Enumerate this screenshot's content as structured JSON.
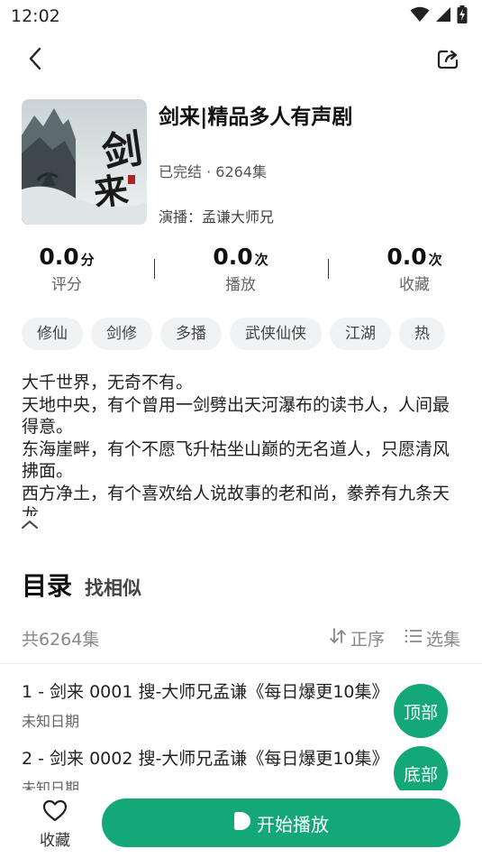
{
  "status_bar": {
    "time": "12:02",
    "icons": [
      "wifi-icon",
      "cellular-signal-icon",
      "battery-charging-icon"
    ]
  },
  "topbar": {
    "back_icon": "chevron-left-icon",
    "share_icon": "share-icon"
  },
  "book": {
    "title": "剑来|精品多人有声剧",
    "meta": "已完结 · 6264集",
    "cast": "演播：孟谦大师兄",
    "cover_text": "剑来"
  },
  "stats": [
    {
      "value": "0.0",
      "unit": "分",
      "label": "评分"
    },
    {
      "value": "0.0",
      "unit": "次",
      "label": "播放"
    },
    {
      "value": "0.0",
      "unit": "次",
      "label": "收藏"
    }
  ],
  "tags": [
    "修仙",
    "剑修",
    "多播",
    "武侠仙侠",
    "江湖",
    "热"
  ],
  "intro": [
    "大千世界，无奇不有。",
    "天地中央，有个曾用一剑劈出天河瀑布的读书人，人间最得意。",
    "东海崖畔，有个不愿飞升枯坐山巅的无名道人，只愿清风拂面。",
    "西方净土，有个喜欢给人说故事的老和尚，豢养有九条天龙"
  ],
  "section": {
    "title": "目录",
    "similar": "找相似"
  },
  "list": {
    "total": "共6264集",
    "sort_label": "正序",
    "select_label": "选集"
  },
  "episodes": [
    {
      "title": "1 - 剑来 0001 搜-大师兄孟谦《每日爆更10集》",
      "date": "未知日期"
    },
    {
      "title": "2 - 剑来 0002 搜-大师兄孟谦《每日爆更10集》",
      "date": "未知日期"
    }
  ],
  "floating": {
    "top_label": "顶部",
    "bottom_label": "底部"
  },
  "bottom_bar": {
    "fav_label": "收藏",
    "play_label": "开始播放"
  },
  "colors": {
    "accent": "#14a878",
    "tag_bg": "#f1f2f4"
  }
}
